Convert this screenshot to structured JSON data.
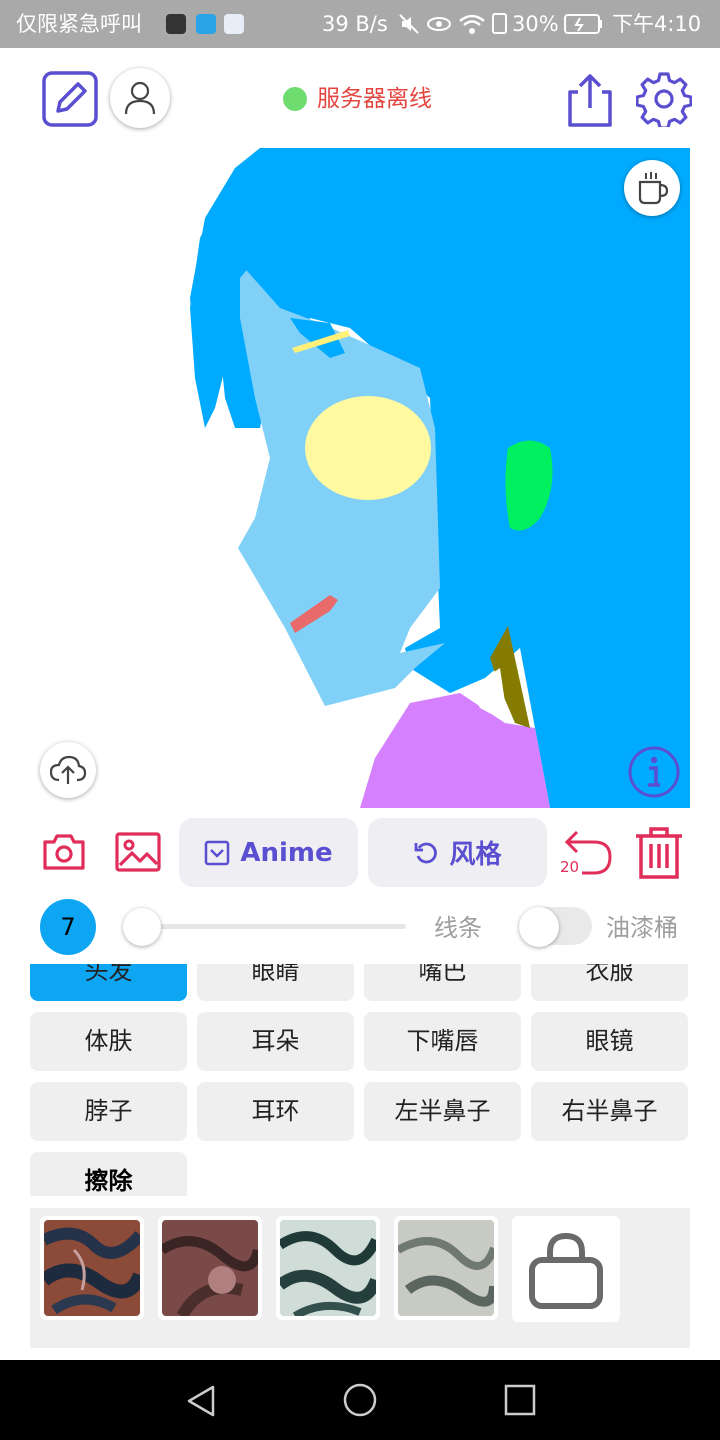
{
  "status_bar": {
    "left_text": "仅限紧急呼叫",
    "net_speed": "39 B/s",
    "battery": "30%",
    "time": "下午4:10"
  },
  "top_bar": {
    "server_status": "服务器离线",
    "colors": {
      "accent": "#5a4fd1",
      "server_dot": "#6fdc6f",
      "server_text": "#e4463f"
    }
  },
  "toolbar": {
    "anime_label": "Anime",
    "style_label": "风格",
    "undo_count": "20"
  },
  "controls": {
    "brush_size": "7",
    "brush_slider_fraction": 0.0,
    "line_label": "线条",
    "bucket_label": "油漆桶",
    "bucket_enabled": false
  },
  "parts": [
    {
      "label": "头发",
      "active": true
    },
    {
      "label": "眼睛"
    },
    {
      "label": "嘴巴"
    },
    {
      "label": "衣服"
    },
    {
      "label": "体肤"
    },
    {
      "label": "耳朵"
    },
    {
      "label": "下嘴唇"
    },
    {
      "label": "眼镜"
    },
    {
      "label": "脖子"
    },
    {
      "label": "耳环"
    },
    {
      "label": "左半鼻子"
    },
    {
      "label": "右半鼻子"
    },
    {
      "label": "擦除"
    }
  ],
  "textures": [
    {
      "icon": "texture-thumbnail"
    },
    {
      "icon": "texture-thumbnail"
    },
    {
      "icon": "texture-thumbnail"
    },
    {
      "icon": "texture-thumbnail"
    },
    {
      "icon": "shop-bag-icon"
    }
  ]
}
